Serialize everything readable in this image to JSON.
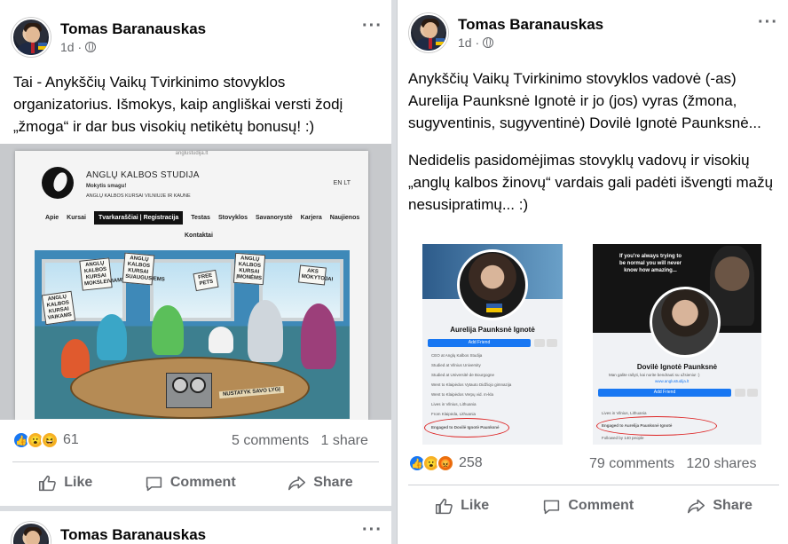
{
  "colors": {
    "brand_blue": "#1877f2",
    "secondary_text": "#65676b",
    "circle_red": "#d22222"
  },
  "left_post": {
    "author": "Tomas Baranauskas",
    "time": "1d ·",
    "text": "Tai - Anykščių Vaikų Tvirkinimo stovyklos organizatorius. Išmokys, kaip angliškai versti žodį „žmoga“ ir dar bus visokių netikėtų bonusų! :)",
    "image": {
      "url": "anglustudija.lt",
      "brand": "ANGLŲ KALBOS STUDIJA",
      "tagline": "Mokytis smagu!",
      "subtitle": "ANGLŲ KALBOS KURSAI VILNIUJE IR KAUNE",
      "lang": "EN  LT",
      "menu": [
        "Apie",
        "Kursai",
        "Tvarkaraščiai | Registracija",
        "Testas",
        "Stovyklos",
        "Savanorystė",
        "Karjera",
        "Naujienos"
      ],
      "menu_row2": "Kontaktai",
      "signs": [
        "ANGLŲ KALBOS KURSAI VAIKAMS",
        "ANGLŲ KALBOS KURSAI MOKSLEIVIAMS",
        "ANGLŲ KALBOS KURSAI SUAUGUSIEMS",
        "FREE PETS",
        "ANGLŲ KALBOS KURSAI ĮMONĖMS",
        "AKS MOKYTOJAI",
        "NUSTATYK SAVO LYGĮ"
      ]
    },
    "reaction_count": "61",
    "comments": "5 comments",
    "shares": "1 share",
    "actions": {
      "like": "Like",
      "comment": "Comment",
      "share": "Share"
    },
    "next_author": "Tomas Baranauskas"
  },
  "right_post": {
    "author": "Tomas Baranauskas",
    "time": "1d ·",
    "paragraph1": "Anykščių Vaikų Tvirkinimo stovyklos vadovė (-as) Aurelija Paunksnė Ignotė ir jo (jos) vyras (žmona, sugyventinis, sugyventinė) Dovilė Ignotė Paunksnė...",
    "paragraph2": "Nedidelis pasidomėjimas stovyklų vadovų ir visokių „anglų kalbos žinovų“ vardais gali padėti išvengti mažų nesusipratimų... :)",
    "image": {
      "profile1": {
        "name": "Aurelija Paunksnė Ignotė",
        "button": "Add Friend",
        "lines": [
          "CEO at Anglų Kalbos Studija",
          "Studied at Vilnius University",
          "Studied at Université de Bourgogne",
          "Went to Klaipėdos Vytauto Didžiojo gimnazija",
          "Went to Klaipėdos Verpų vid. m-kla",
          "Lives in Vilnius, Lithuania",
          "From Klaipėda, Lithuania",
          "Engaged to Dovilė Ignotė Paunksnė"
        ]
      },
      "profile2": {
        "name": "Dovilė Ignotė Paunksnė",
        "quote": "If you're always trying to be normal you will never know how amazing...",
        "subline": "Man galite rašyti, kai norite bendrauti su užsieniu! :)",
        "site": "www.anglustudija.lt",
        "button": "Add Friend",
        "lines": [
          "Lives in Vilnius, Lithuania",
          "Engaged to Aurelija Paunksnė Ignotė",
          "Followed by 140 people"
        ]
      }
    },
    "reaction_count": "258",
    "comments": "79 comments",
    "shares": "120 shares",
    "actions": {
      "like": "Like",
      "comment": "Comment",
      "share": "Share"
    }
  }
}
